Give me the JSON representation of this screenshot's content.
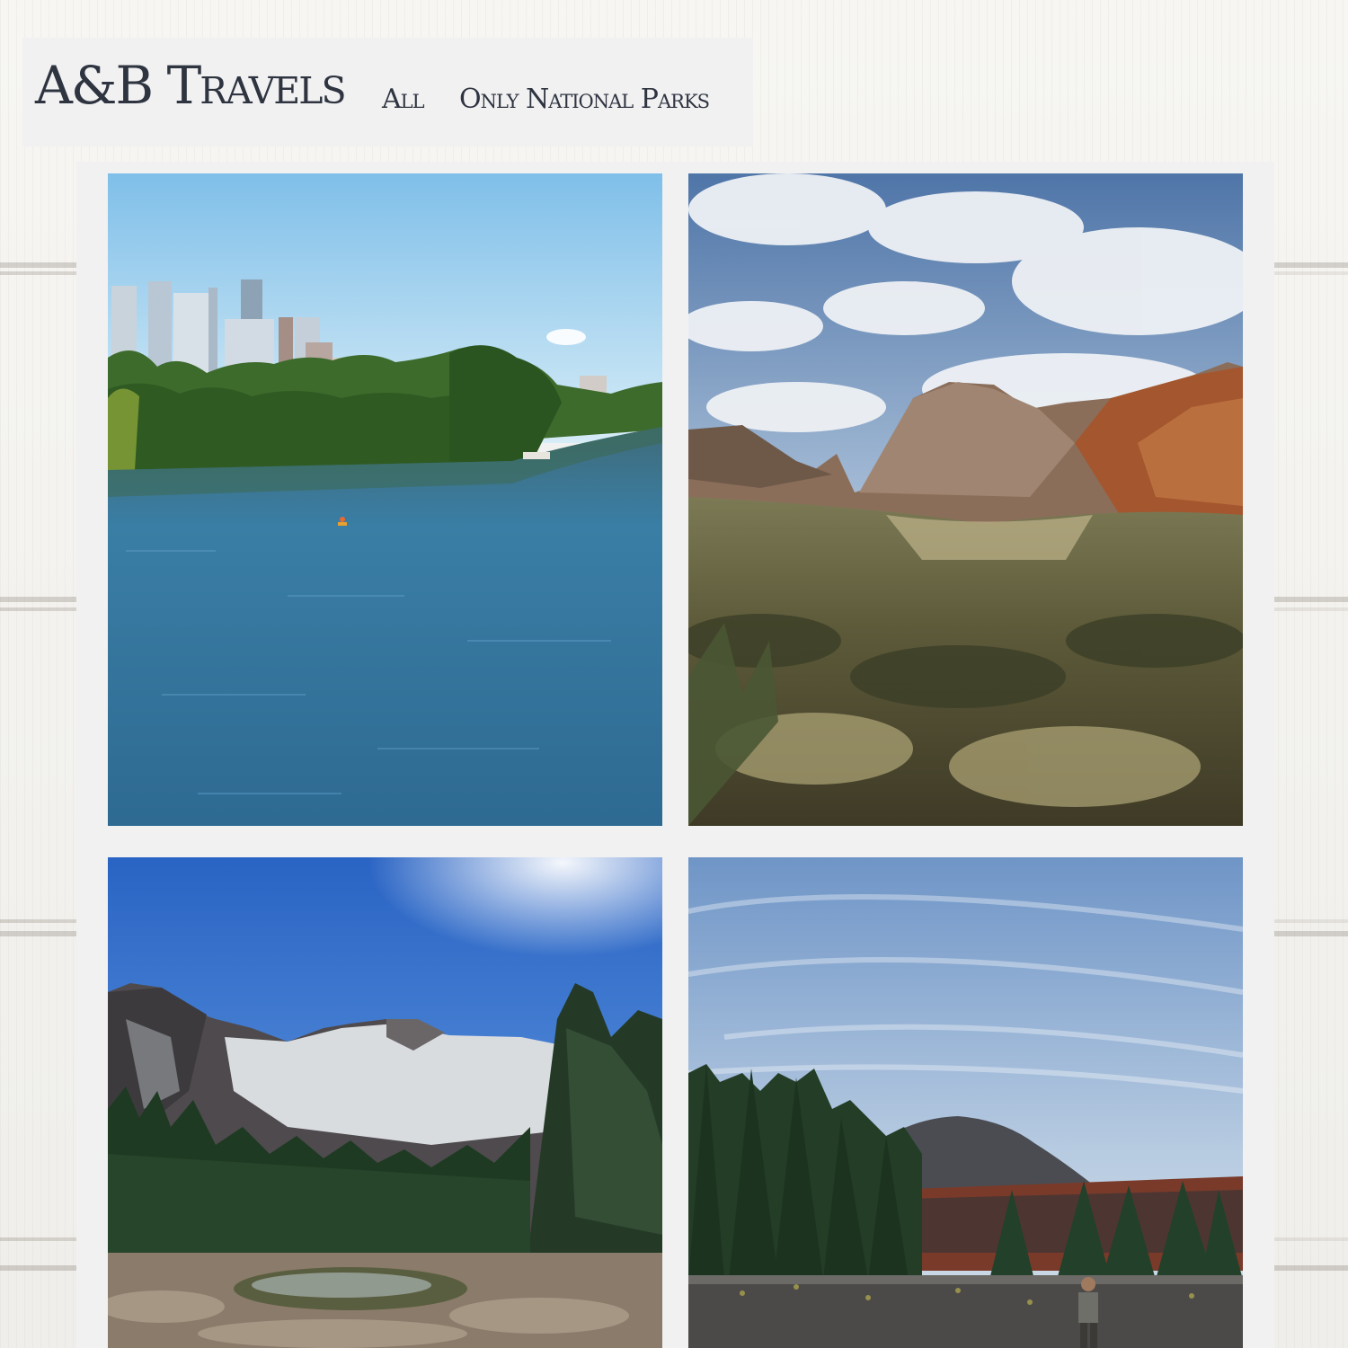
{
  "header": {
    "brand": "A&B Travels",
    "nav": [
      {
        "label": "All"
      },
      {
        "label": "Only National Parks"
      }
    ]
  },
  "gallery": {
    "photos": [
      {
        "icon": "city-lake-photo"
      },
      {
        "icon": "desert-mountain-photo"
      },
      {
        "icon": "alpine-lake-photo"
      },
      {
        "icon": "volcanic-cone-photo"
      }
    ]
  },
  "colors": {
    "header_bg": "#f1f1f2",
    "text": "#2e3440",
    "gallery_bg": "#f1f1f1"
  }
}
